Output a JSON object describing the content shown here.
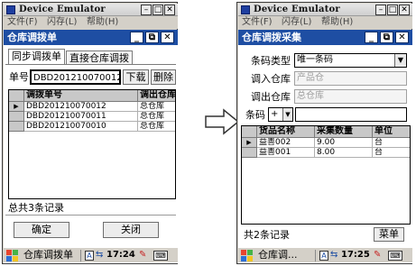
{
  "colors": {
    "title_bar": "#1e4ea3",
    "emulator_chrome": "#d4d0c8",
    "grid_header": "#c8c8c8"
  },
  "left": {
    "emulator_title": "Device Emulator",
    "menu": [
      "文件(F)",
      "闪存(L)",
      "帮助(H)"
    ],
    "app_title": "仓库调拨单",
    "title_buttons": [
      "_",
      "⧉",
      "✕"
    ],
    "tabs": [
      "同步调拨单",
      "直接仓库调拨"
    ],
    "order_label": "单号",
    "order_value": "DBD201210070012",
    "download_label": "下载",
    "delete_label": "删除",
    "grid_headers": [
      "调拨单号",
      "调出仓库"
    ],
    "rows": [
      {
        "order": "DBD201210070012",
        "warehouse": "总仓库"
      },
      {
        "order": "DBD201210070011",
        "warehouse": "总仓库"
      },
      {
        "order": "DBD201210070010",
        "warehouse": "总仓库"
      }
    ],
    "footer_text": "总共3条记录",
    "confirm_label": "确定",
    "close_label": "关闭",
    "taskbar_app": "仓库调拨单",
    "time": "17:24"
  },
  "arrow": {
    "glyph": "⇨"
  },
  "right": {
    "emulator_title": "Device Emulator",
    "menu": [
      "文件(F)",
      "闪存(L)",
      "帮助(H)"
    ],
    "app_title": "仓库调拨采集",
    "title_buttons": [
      "_",
      "⧉",
      "✕"
    ],
    "barcode_type_label": "条码类型",
    "barcode_type_value": "唯一条码",
    "in_warehouse_label": "调入仓库",
    "in_warehouse_value": "产品仓",
    "out_warehouse_label": "调出仓库",
    "out_warehouse_value": "总仓库",
    "barcode_label": "条码",
    "barcode_sign": "+",
    "barcode_value": "",
    "grid_headers": [
      "货品名称",
      "采集数量",
      "单位"
    ],
    "rows": [
      {
        "name": "益善002",
        "qty": "9.00",
        "unit": "台"
      },
      {
        "name": "益善001",
        "qty": "8.00",
        "unit": "台"
      }
    ],
    "footer_text": "共2条记录",
    "menu_button_label": "菜单",
    "taskbar_app": "仓库调...",
    "time": "17:25"
  }
}
